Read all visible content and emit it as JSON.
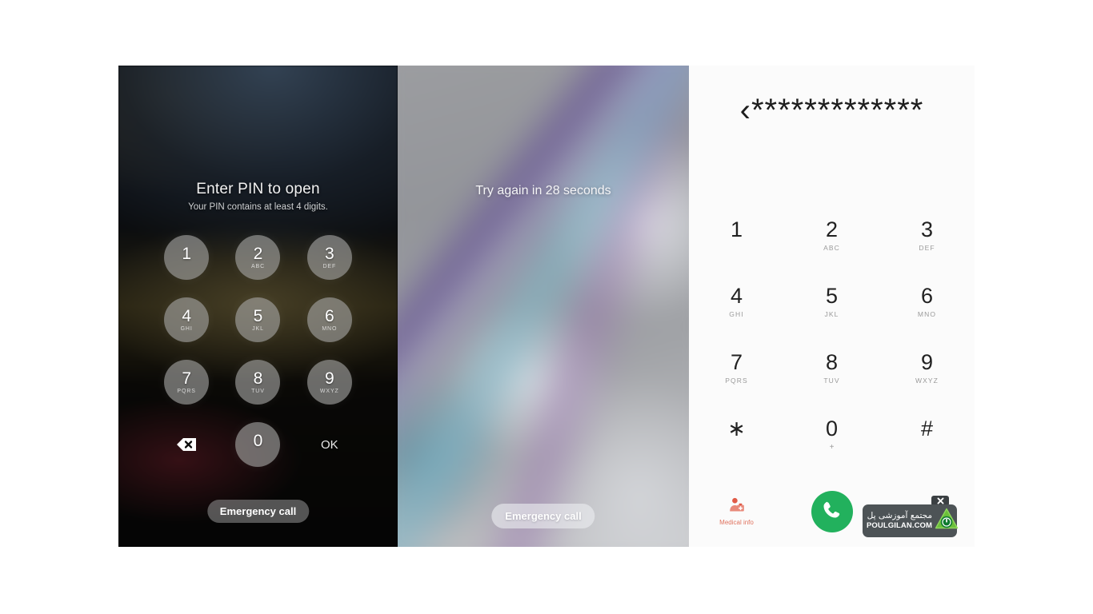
{
  "pin_lock": {
    "title": "Enter PIN to open",
    "subtitle": "Your PIN contains at least 4 digits.",
    "keys": [
      {
        "digit": "1",
        "letters": ""
      },
      {
        "digit": "2",
        "letters": "ABC"
      },
      {
        "digit": "3",
        "letters": "DEF"
      },
      {
        "digit": "4",
        "letters": "GHI"
      },
      {
        "digit": "5",
        "letters": "JKL"
      },
      {
        "digit": "6",
        "letters": "MNO"
      },
      {
        "digit": "7",
        "letters": "PQRS"
      },
      {
        "digit": "8",
        "letters": "TUV"
      },
      {
        "digit": "9",
        "letters": "WXYZ"
      }
    ],
    "backspace_icon": "backspace-icon",
    "zero": {
      "digit": "0",
      "letters": ""
    },
    "ok_label": "OK",
    "emergency_label": "Emergency call"
  },
  "timeout_lock": {
    "message": "Try again in 28 seconds",
    "emergency_label": "Emergency call"
  },
  "dialer": {
    "display_value": "‹*************",
    "keys": [
      {
        "digit": "1",
        "letters": ""
      },
      {
        "digit": "2",
        "letters": "ABC"
      },
      {
        "digit": "3",
        "letters": "DEF"
      },
      {
        "digit": "4",
        "letters": "GHI"
      },
      {
        "digit": "5",
        "letters": "JKL"
      },
      {
        "digit": "6",
        "letters": "MNO"
      },
      {
        "digit": "7",
        "letters": "PQRS"
      },
      {
        "digit": "8",
        "letters": "TUV"
      },
      {
        "digit": "9",
        "letters": "WXYZ"
      },
      {
        "digit": "∗",
        "letters": ""
      },
      {
        "digit": "0",
        "letters": "+"
      },
      {
        "digit": "#",
        "letters": ""
      }
    ],
    "medical_info_label": "Medical info",
    "medical_info_icon": "medical-person-icon",
    "call_icon": "phone-handset-icon"
  },
  "watermark": {
    "persian_text": "مجتمع آموزشی پل",
    "site": "POULGILAN.COM",
    "close_icon": "close-icon",
    "logo_icon": "power-triangle-logo-icon"
  },
  "colors": {
    "call_green": "#22b15d",
    "medical_red": "#e0735f",
    "watermark_bg": "#4d5356",
    "logo_green": "#53a932"
  }
}
